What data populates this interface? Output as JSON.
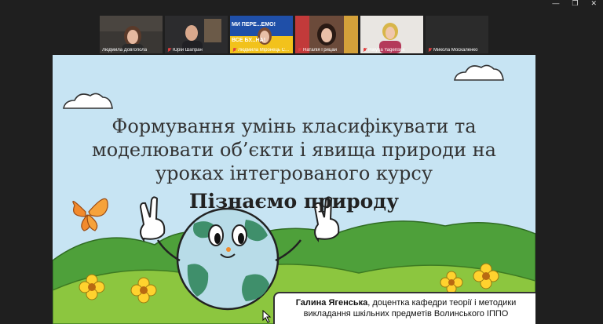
{
  "window": {
    "minimize_glyph": "—",
    "maximize_glyph": "❐",
    "close_glyph": "✕"
  },
  "participants": [
    {
      "name": "Людмила Довгопола",
      "muted": false,
      "active": true
    },
    {
      "name": "Юрій Шапран",
      "muted": true,
      "active": false
    },
    {
      "name": "Людмила Міронець С...",
      "muted": true,
      "active": false,
      "banner_top": "МИ ПЕРЕ...ЕМО!",
      "banner_bottom": "ВСЕ БУ...НА!"
    },
    {
      "name": "Наталія Грицай",
      "muted": true,
      "active": false
    },
    {
      "name": "Halyna Yagenska",
      "muted": true,
      "active": false
    },
    {
      "name": "Микола Москаленко",
      "muted": true,
      "active": false
    }
  ],
  "slide": {
    "title_lines": [
      "Формування умінь класифікувати та",
      "моделювати об’єкти і явища природи на",
      "уроках інтегрованого курсу"
    ],
    "subtitle": "Пізнаємо природу",
    "caption_name": "Галина Ягенська",
    "caption_line1_rest": ", доцентка кафедри теорії і методики",
    "caption_line2": "викладання шкільних предметів Волинського ІППО"
  },
  "colors": {
    "sky": "#c7e4f3",
    "grass_light": "#8cc63f",
    "grass_dark": "#4ea03a",
    "earth_sea": "#b8dce8",
    "earth_land": "#3f8f6b",
    "active_border": "#2e8b57"
  }
}
